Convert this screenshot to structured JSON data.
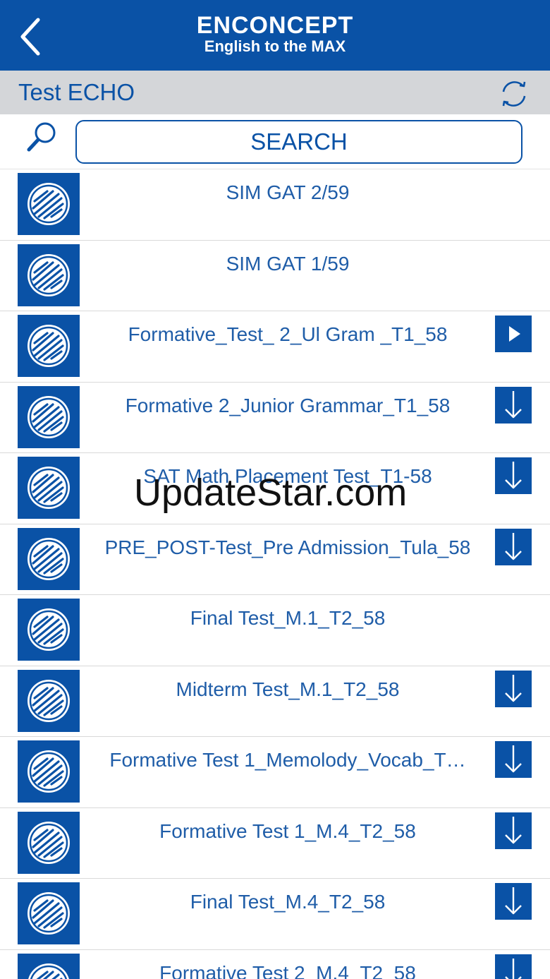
{
  "header": {
    "brand_name": "ENCONCEPT",
    "brand_tagline": "English to the MAX"
  },
  "subheader": {
    "title": "Test ECHO"
  },
  "search": {
    "label": "SEARCH"
  },
  "tests": [
    {
      "title": "SIM GAT 2/59",
      "action": "none"
    },
    {
      "title": "SIM GAT 1/59",
      "action": "none"
    },
    {
      "title": "Formative_Test_ 2_Ul Gram _T1_58",
      "action": "play"
    },
    {
      "title": "Formative 2_Junior Grammar_T1_58",
      "action": "download"
    },
    {
      "title": "SAT Math Placement Test_T1-58",
      "action": "download"
    },
    {
      "title": "PRE_POST-Test_Pre Admission_Tula_58",
      "action": "download"
    },
    {
      "title": "Final Test_M.1_T2_58",
      "action": "none"
    },
    {
      "title": "Midterm Test_M.1_T2_58",
      "action": "download"
    },
    {
      "title": "Formative Test 1_Memolody_Vocab_T…",
      "action": "download"
    },
    {
      "title": "Formative Test 1_M.4_T2_58",
      "action": "download"
    },
    {
      "title": "Final Test_M.4_T2_58",
      "action": "download"
    },
    {
      "title": "Formative Test 2_M.4_T2_58",
      "action": "download"
    }
  ],
  "watermark": "UpdateStar.com",
  "colors": {
    "brand_blue": "#0a52a6",
    "subbar_gray": "#d4d6d9",
    "text_blue": "#1f5da8"
  }
}
